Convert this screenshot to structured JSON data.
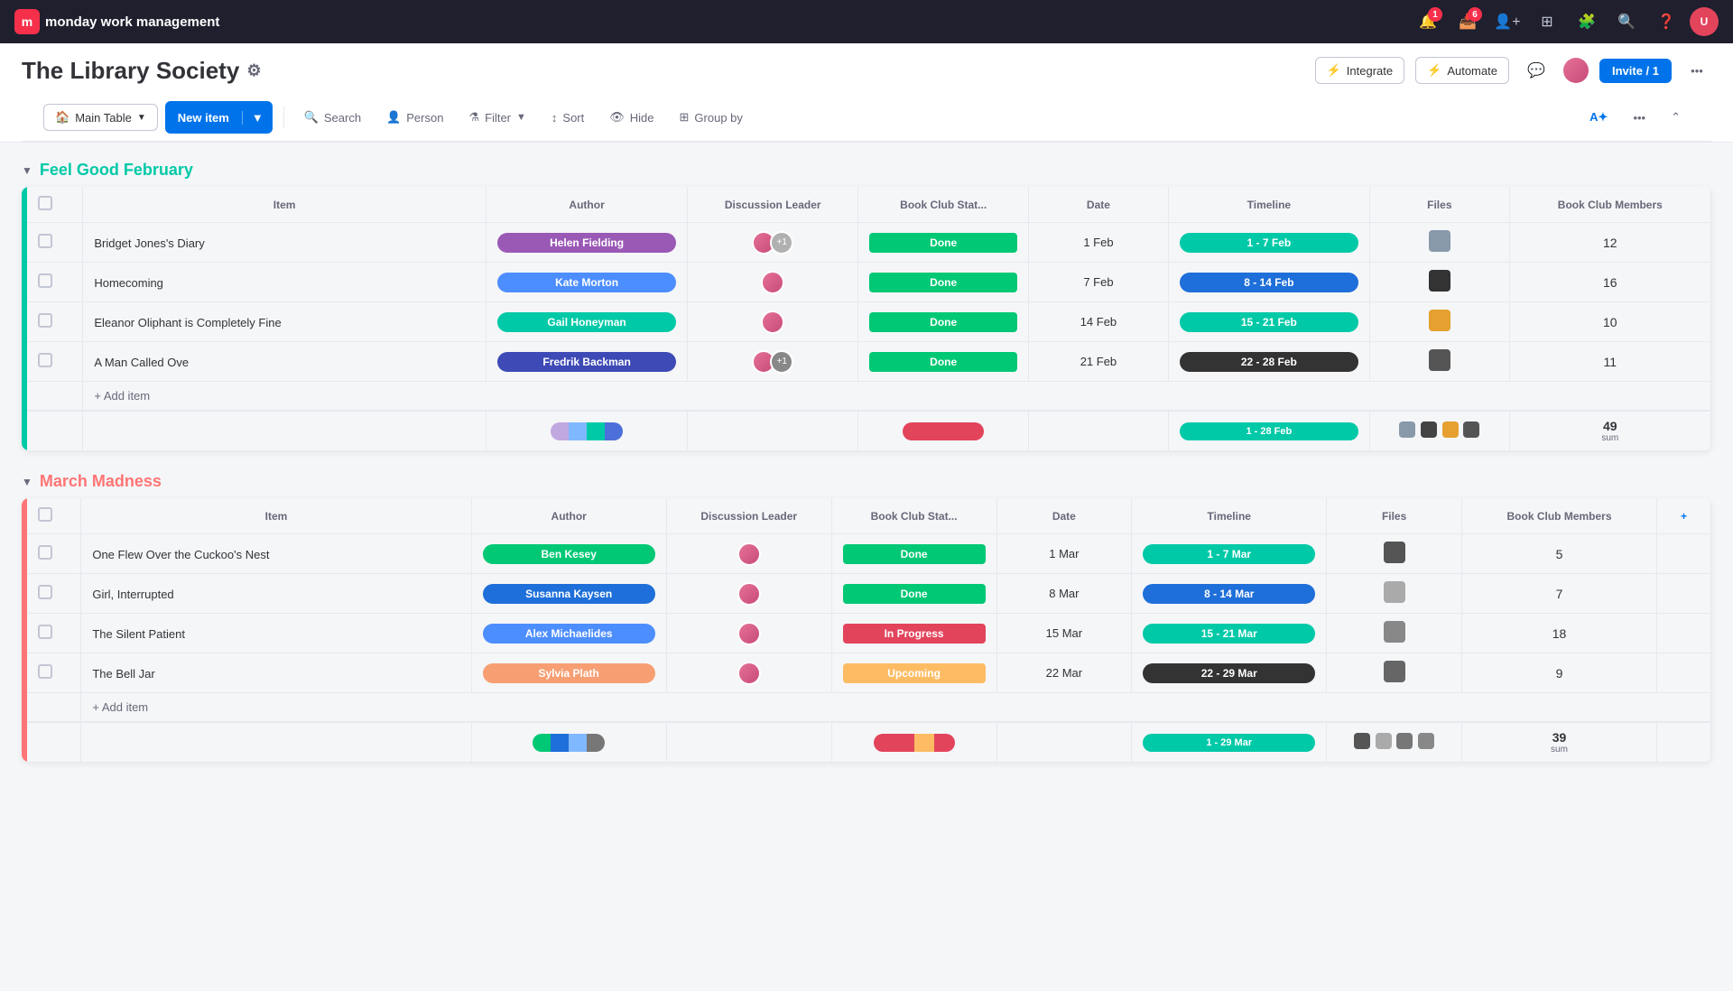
{
  "app": {
    "title": "monday work management",
    "logo_text": "monday"
  },
  "nav": {
    "notifications_count": "1",
    "inbox_count": "6"
  },
  "board": {
    "title": "The Library Society",
    "invite_label": "Invite / 1",
    "integrate_label": "Integrate",
    "automate_label": "Automate"
  },
  "toolbar": {
    "view_label": "Main Table",
    "new_item_label": "New item",
    "search_label": "Search",
    "person_label": "Person",
    "filter_label": "Filter",
    "sort_label": "Sort",
    "hide_label": "Hide",
    "group_by_label": "Group by"
  },
  "groups": [
    {
      "id": "feel-good-february",
      "title": "Feel Good February",
      "color": "teal",
      "columns": [
        "Item",
        "Author",
        "Discussion Leader",
        "Book Club Stat...",
        "Date",
        "Timeline",
        "Files",
        "Book Club Members"
      ],
      "rows": [
        {
          "item": "Bridget Jones's Diary",
          "author": "Helen Fielding",
          "author_color": "purple",
          "status": "Done",
          "status_color": "done",
          "date": "1 Feb",
          "timeline": "1 - 7 Feb",
          "timeline_color": "teal",
          "files_count": 1,
          "members": "12"
        },
        {
          "item": "Homecoming",
          "author": "Kate Morton",
          "author_color": "blue",
          "status": "Done",
          "status_color": "done",
          "date": "7 Feb",
          "timeline": "8 - 14 Feb",
          "timeline_color": "darkblue",
          "files_count": 1,
          "members": "16"
        },
        {
          "item": "Eleanor Oliphant is Completely Fine",
          "author": "Gail Honeyman",
          "author_color": "teal",
          "status": "Done",
          "status_color": "done",
          "date": "14 Feb",
          "timeline": "15 - 21 Feb",
          "timeline_color": "teal",
          "files_count": 1,
          "members": "10"
        },
        {
          "item": "A Man Called Ove",
          "author": "Fredrik Backman",
          "author_color": "navy",
          "status": "Done",
          "status_color": "done",
          "date": "21 Feb",
          "timeline": "22 - 28 Feb",
          "timeline_color": "dark",
          "files_count": 1,
          "members": "11"
        }
      ],
      "summary": {
        "timeline_range": "1 - 28 Feb",
        "total_members": "49"
      }
    },
    {
      "id": "march-madness",
      "title": "March Madness",
      "color": "orange",
      "columns": [
        "Item",
        "Author",
        "Discussion Leader",
        "Book Club Stat...",
        "Date",
        "Timeline",
        "Files",
        "Book Club Members"
      ],
      "rows": [
        {
          "item": "One Flew Over the Cuckoo's Nest",
          "author": "Ben Kesey",
          "author_color": "green",
          "status": "Done",
          "status_color": "done",
          "date": "1 Mar",
          "timeline": "1 - 7 Mar",
          "timeline_color": "teal",
          "files_count": 1,
          "members": "5"
        },
        {
          "item": "Girl, Interrupted",
          "author": "Susanna Kaysen",
          "author_color": "darkblue",
          "status": "Done",
          "status_color": "done",
          "date": "8 Mar",
          "timeline": "8 - 14 Mar",
          "timeline_color": "darkblue",
          "files_count": 1,
          "members": "7"
        },
        {
          "item": "The Silent Patient",
          "author": "Alex Michaelides",
          "author_color": "blue",
          "status": "In Progress",
          "status_color": "inprogress",
          "date": "15 Mar",
          "timeline": "15 - 21 Mar",
          "timeline_color": "teal",
          "files_count": 1,
          "members": "18"
        },
        {
          "item": "The Bell Jar",
          "author": "Sylvia Plath",
          "author_color": "salmon",
          "status": "Upcoming",
          "status_color": "upcoming",
          "date": "22 Mar",
          "timeline": "22 - 29 Mar",
          "timeline_color": "dark",
          "files_count": 1,
          "members": "9"
        }
      ],
      "summary": {
        "timeline_range": "1 - 29 Mar",
        "total_members": "39"
      }
    }
  ],
  "labels": {
    "add_item": "+ Add item",
    "sum": "sum"
  }
}
